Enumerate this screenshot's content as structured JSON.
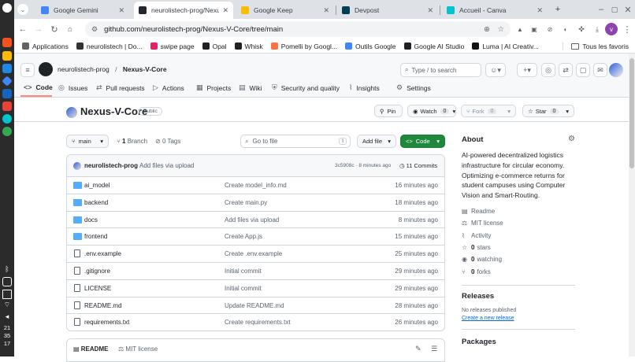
{
  "clock": {
    "h": "21",
    "m": "35",
    "s": "17"
  },
  "tabs": [
    {
      "title": "Google Gemini",
      "color": "#4285f4"
    },
    {
      "title": "neurolistech-prog/Nexus-V",
      "color": "#24292f",
      "active": true
    },
    {
      "title": "Google Keep",
      "color": "#fbbc04"
    },
    {
      "title": "Devpost",
      "color": "#003e54"
    },
    {
      "title": "Accueil - Canva",
      "color": "#00c4cc"
    }
  ],
  "url": "github.com/neurolistech-prog/Nexus-V-Core/tree/main",
  "profile_letter": "v",
  "bookmarks": [
    {
      "label": "Applications",
      "color": "#5f6368"
    },
    {
      "label": "neurolistech | Do...",
      "color": "#333"
    },
    {
      "label": "swipe page",
      "color": "#e91e63"
    },
    {
      "label": "Opal",
      "color": "#202124"
    },
    {
      "label": "Whisk",
      "color": "#202124"
    },
    {
      "label": "Pomelli by Googl...",
      "color": "#ff7043"
    },
    {
      "label": "Outils Google",
      "color": "#4285f4"
    },
    {
      "label": "Google AI Studio",
      "color": "#202124"
    },
    {
      "label": "Luma | AI Creativ...",
      "color": "#111"
    }
  ],
  "all_bookmarks": "Tous les favoris",
  "header": {
    "owner": "neurolistech-prog",
    "slash": "/",
    "repo": "Nexus-V-Core",
    "search_placeholder": "Type / to search"
  },
  "nav": [
    {
      "label": "Code",
      "icon": "<>"
    },
    {
      "label": "Issues",
      "icon": "◎"
    },
    {
      "label": "Pull requests",
      "icon": "⇄"
    },
    {
      "label": "Actions",
      "icon": "▷"
    },
    {
      "label": "Projects",
      "icon": "▦"
    },
    {
      "label": "Wiki",
      "icon": "▤"
    },
    {
      "label": "Security and quality",
      "icon": "⛨"
    },
    {
      "label": "Insights",
      "icon": "⌇"
    },
    {
      "label": "Settings",
      "icon": "⚙"
    }
  ],
  "repo": {
    "name": "Nexus-V-Core",
    "visibility": "Public",
    "pin": "Pin",
    "watch": "Watch",
    "watch_count": "0",
    "fork": "Fork",
    "fork_count": "0",
    "star": "Star",
    "star_count": "0"
  },
  "branchbar": {
    "branch": "main",
    "branches_count": "1",
    "branches_label": "Branch",
    "tags_count": "0",
    "tags_label": "Tags",
    "goto_placeholder": "Go to file",
    "goto_key": "t",
    "add_file": "Add file",
    "code": "Code"
  },
  "commit": {
    "author": "neurolistech-prog",
    "message": "Add files via upload",
    "meta": "3c5908c · 8 minutes ago",
    "commits": "11 Commits"
  },
  "files": [
    {
      "name": "ai_model",
      "type": "dir",
      "msg": "Create model_info.md",
      "time": "16 minutes ago"
    },
    {
      "name": "backend",
      "type": "dir",
      "msg": "Create main.py",
      "time": "18 minutes ago"
    },
    {
      "name": "docs",
      "type": "dir",
      "msg": "Add files via upload",
      "time": "8 minutes ago"
    },
    {
      "name": "frontend",
      "type": "dir",
      "msg": "Create App.js",
      "time": "15 minutes ago"
    },
    {
      "name": ".env.example",
      "type": "file",
      "msg": "Create .env.example",
      "time": "25 minutes ago"
    },
    {
      "name": ".gitignore",
      "type": "file",
      "msg": "Initial commit",
      "time": "29 minutes ago"
    },
    {
      "name": "LICENSE",
      "type": "file",
      "msg": "Initial commit",
      "time": "29 minutes ago"
    },
    {
      "name": "README.md",
      "type": "file",
      "msg": "Update README.md",
      "time": "28 minutes ago"
    },
    {
      "name": "requirements.txt",
      "type": "file",
      "msg": "Create requirements.txt",
      "time": "26 minutes ago"
    }
  ],
  "readme_tabs": {
    "readme": "README",
    "license": "MIT license"
  },
  "about": {
    "title": "About",
    "description": "AI-powered decentralized logistics infrastructure for circular economy. Optimizing e-commerce returns for student campuses using Computer Vision and Smart-Routing.",
    "readme": "Readme",
    "license": "MIT license",
    "activity": "Activity",
    "stars_count": "0",
    "stars_label": "stars",
    "watching_count": "0",
    "watching_label": "watching",
    "forks_count": "0",
    "forks_label": "forks"
  },
  "releases": {
    "title": "Releases",
    "none": "No releases published",
    "create": "Create a new release"
  },
  "packages": {
    "title": "Packages"
  }
}
